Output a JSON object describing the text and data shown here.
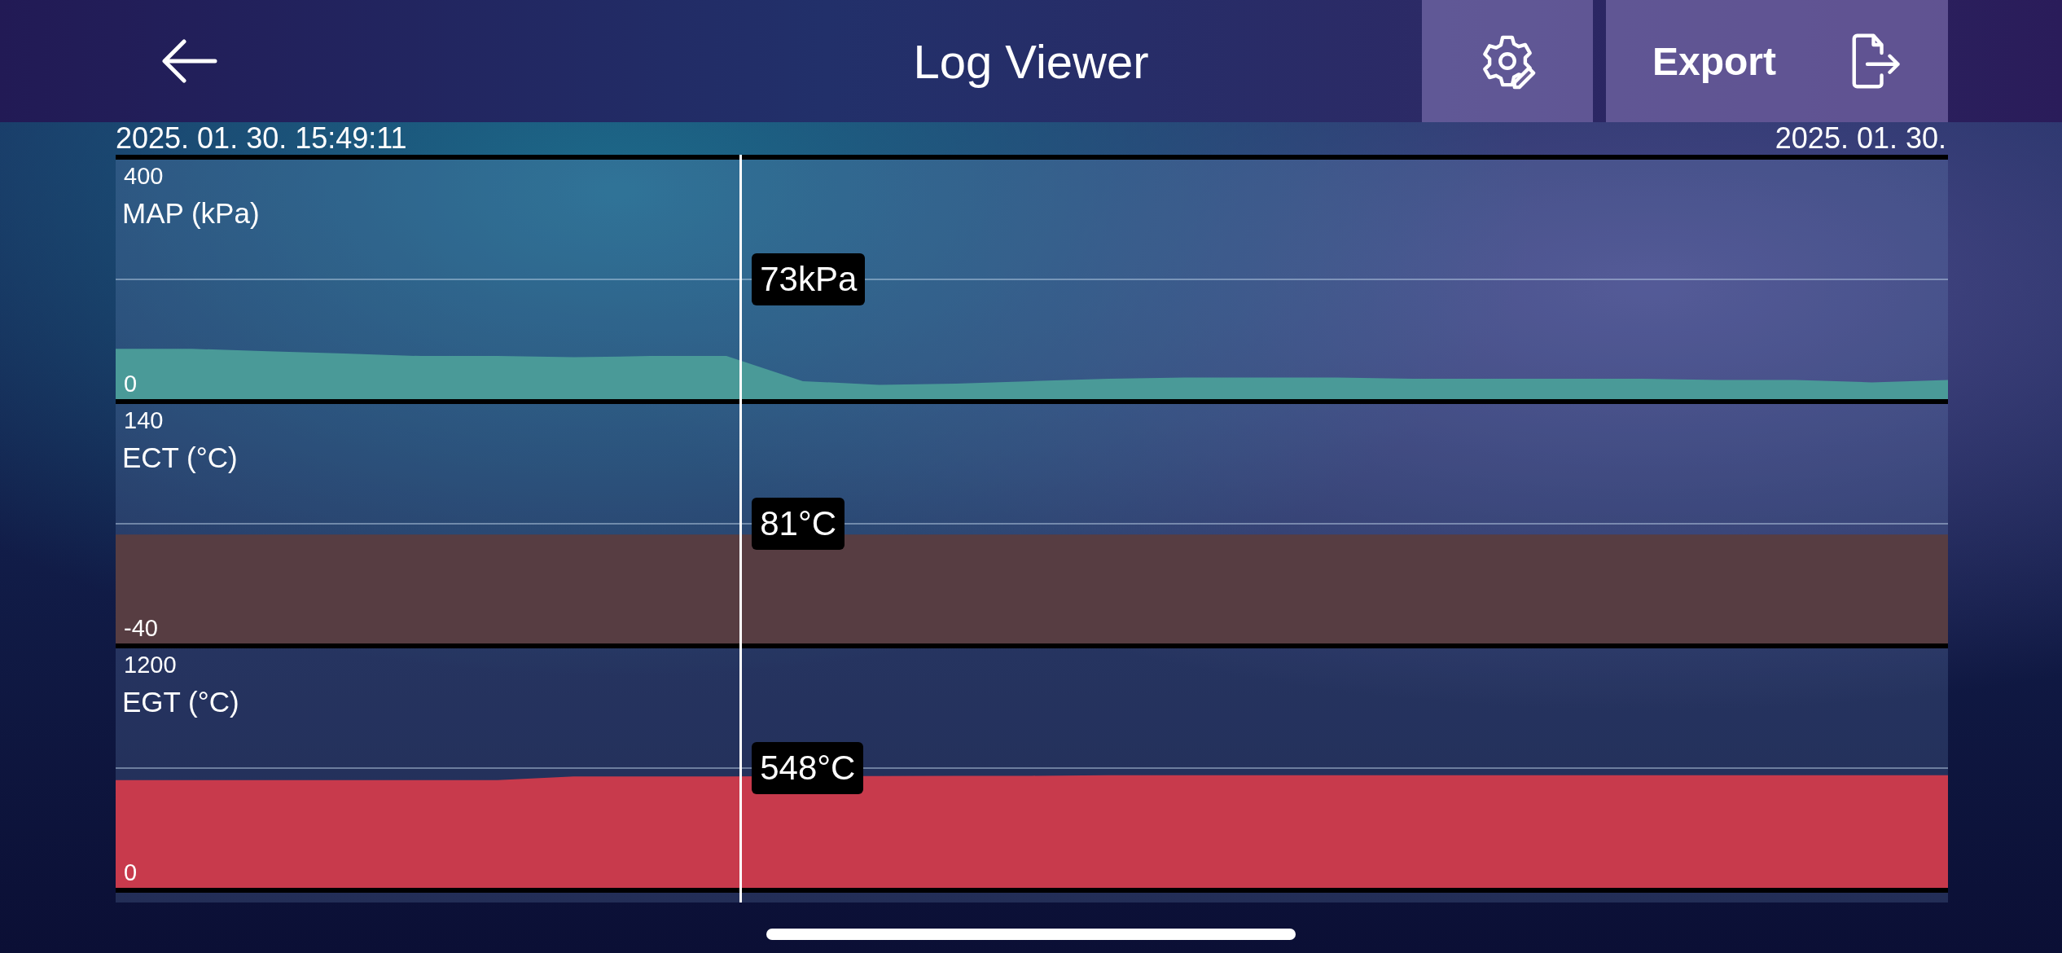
{
  "header": {
    "title": "Log Viewer",
    "export_label": "Export"
  },
  "time_range": {
    "start": "2025. 01. 30. 15:49:11",
    "end": "2025. 01. 30."
  },
  "cursor": {
    "level": 0.341
  },
  "panels": [
    {
      "kind": "map",
      "label": "MAP (kPa)",
      "max": "400",
      "min": "0",
      "readout": "73kPa",
      "color": "#4a9a98"
    },
    {
      "kind": "ect",
      "label": "ECT (°C)",
      "max": "140",
      "min": "-40",
      "readout": "81°C",
      "color": "#573d42"
    },
    {
      "kind": "egt",
      "label": "EGT (°C)",
      "max": "1200",
      "min": "0",
      "readout": "548°C",
      "color": "#c83a4c"
    }
  ]
}
